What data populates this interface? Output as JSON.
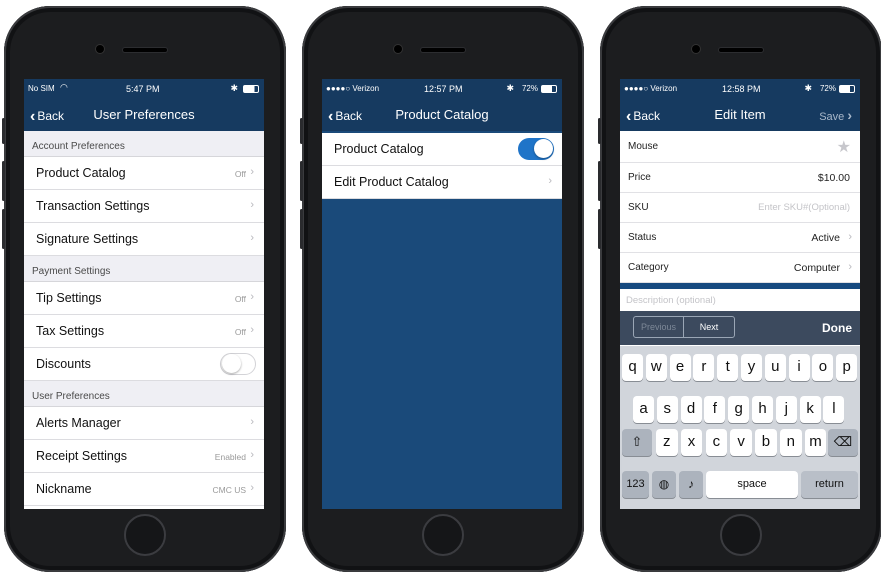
{
  "phone1": {
    "status": {
      "carrier": "No SIM",
      "time": "5:47 PM"
    },
    "nav": {
      "back": "Back",
      "title": "User Preferences"
    },
    "sections": {
      "account": "Account Preferences",
      "payment": "Payment Settings",
      "user": "User Preferences"
    },
    "rows": {
      "product_catalog": {
        "label": "Product Catalog",
        "value": "Off"
      },
      "transaction": {
        "label": "Transaction Settings"
      },
      "signature": {
        "label": "Signature Settings"
      },
      "tip": {
        "label": "Tip Settings",
        "value": "Off"
      },
      "tax": {
        "label": "Tax Settings",
        "value": "Off"
      },
      "discounts": {
        "label": "Discounts",
        "toggle": "off"
      },
      "alerts": {
        "label": "Alerts Manager"
      },
      "receipt": {
        "label": "Receipt Settings",
        "value": "Enabled"
      },
      "nickname": {
        "label": "Nickname",
        "value": "CMC US"
      }
    }
  },
  "phone2": {
    "status": {
      "carrier": "●●●●○ Verizon",
      "time": "12:57 PM",
      "battery": "72%"
    },
    "nav": {
      "back": "Back",
      "title": "Product Catalog"
    },
    "rows": {
      "product_catalog": {
        "label": "Product Catalog",
        "toggle": "on"
      },
      "edit_catalog": {
        "label": "Edit Product Catalog"
      }
    }
  },
  "phone3": {
    "status": {
      "carrier": "●●●●○ Verizon",
      "time": "12:58 PM",
      "battery": "72%"
    },
    "nav": {
      "back": "Back",
      "title": "Edit Item",
      "save": "Save"
    },
    "form": {
      "name_value": "Mouse",
      "price": {
        "label": "Price",
        "value": "$10.00"
      },
      "sku": {
        "label": "SKU",
        "placeholder": "Enter SKU#(Optional)"
      },
      "status": {
        "label": "Status",
        "value": "Active"
      },
      "category": {
        "label": "Category",
        "value": "Computer"
      },
      "description_placeholder": "Description (optional)"
    },
    "toolbar": {
      "previous": "Previous",
      "next": "Next",
      "done": "Done"
    },
    "keyboard": {
      "row1": [
        "q",
        "w",
        "e",
        "r",
        "t",
        "y",
        "u",
        "i",
        "o",
        "p"
      ],
      "row2": [
        "a",
        "s",
        "d",
        "f",
        "g",
        "h",
        "j",
        "k",
        "l"
      ],
      "row3": [
        "z",
        "x",
        "c",
        "v",
        "b",
        "n",
        "m"
      ],
      "num_label": "123",
      "space_label": "space",
      "return_label": "return"
    }
  },
  "colors": {
    "nav": "#163a60",
    "toggle_on": "#1f74c8",
    "catalog_bg": "#1a4a7a",
    "separator": "#164a80"
  }
}
